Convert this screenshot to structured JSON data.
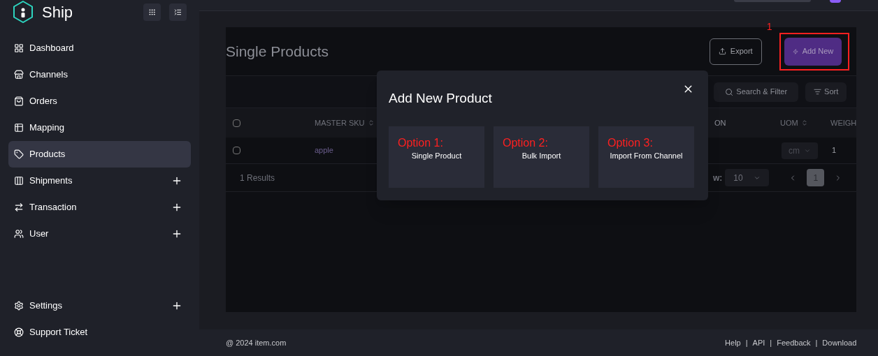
{
  "brand": {
    "name": "Ship"
  },
  "sidebar": {
    "items": [
      {
        "label": "Dashboard",
        "selected": false,
        "expandable": false
      },
      {
        "label": "Channels",
        "selected": false,
        "expandable": false
      },
      {
        "label": "Orders",
        "selected": false,
        "expandable": false
      },
      {
        "label": "Mapping",
        "selected": false,
        "expandable": false
      },
      {
        "label": "Products",
        "selected": true,
        "expandable": false
      },
      {
        "label": "Shipments",
        "selected": false,
        "expandable": true
      },
      {
        "label": "Transaction",
        "selected": false,
        "expandable": true
      },
      {
        "label": "User",
        "selected": false,
        "expandable": true
      }
    ],
    "bottom_items": [
      {
        "label": "Settings",
        "selected": false,
        "expandable": true
      },
      {
        "label": "Support Ticket",
        "selected": false,
        "expandable": false
      }
    ]
  },
  "page": {
    "title": "Single Products",
    "export_button": "Export",
    "add_button": "Add New",
    "annotation": "1"
  },
  "toolbar": {
    "search_button": "Search & Filter",
    "sort_button": "Sort"
  },
  "table": {
    "columns": [
      "MASTER SKU",
      "ON",
      "UOM",
      "WEIGH"
    ],
    "rows": [
      {
        "checked": false,
        "master_sku": "apple",
        "uom": "cm",
        "weight": "1"
      }
    ],
    "header_checked": false
  },
  "pagination": {
    "results": "1 Results",
    "rows_label": "w:",
    "page_size": "10",
    "pages": [
      {
        "label": "1",
        "selected": true
      }
    ]
  },
  "modal": {
    "title": "Add New Product",
    "options": [
      {
        "annotation": "Option 1:",
        "label": "Single Product"
      },
      {
        "annotation": "Option 2:",
        "label": "Bulk Import"
      },
      {
        "annotation": "Option 3:",
        "label": "Import From Channel"
      }
    ]
  },
  "footer": {
    "copyright": "@ 2024 item.com",
    "separator": "|",
    "links": [
      "Help",
      "API",
      "Feedback",
      "Download"
    ]
  }
}
